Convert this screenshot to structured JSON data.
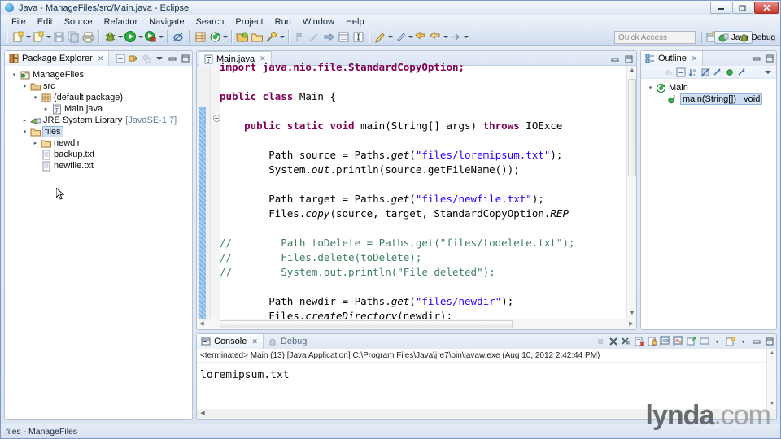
{
  "window": {
    "title": "Java - ManageFiles/src/Main.java - Eclipse",
    "minimize_label": "—",
    "restore_label": "❐",
    "close_label": "✕"
  },
  "menubar": {
    "items": [
      "File",
      "Edit",
      "Source",
      "Refactor",
      "Navigate",
      "Search",
      "Project",
      "Run",
      "Window",
      "Help"
    ]
  },
  "toolbar": {
    "quick_access_placeholder": "Quick Access",
    "perspective_java": "Java",
    "perspective_debug": "Debug",
    "icons": [
      "new-wizard-icon",
      "save-icon",
      "save-all-icon",
      "print-icon",
      "debug-icon",
      "run-icon",
      "run-external-tools-icon",
      "skip-breakpoints-icon",
      "new-java-package-icon",
      "new-java-class-icon",
      "open-type-icon",
      "search-icon",
      "annotation-icon",
      "next-annotation-icon",
      "previous-annotation-icon",
      "last-edit-location-icon",
      "back-icon",
      "forward-icon"
    ]
  },
  "package_explorer": {
    "title": "Package Explorer",
    "close_label": "✕",
    "buttons": [
      "collapse-all-icon",
      "link-with-editor-icon",
      "focus-on-active-task-icon",
      "view-menu-icon",
      "minimize-icon",
      "maximize-icon"
    ],
    "tree": [
      {
        "label": "ManageFiles",
        "icon": "java-project-icon",
        "indent": 0,
        "state": "open",
        "selected": false,
        "dim": ""
      },
      {
        "label": "src",
        "icon": "source-folder-icon",
        "indent": 1,
        "state": "open",
        "selected": false,
        "dim": ""
      },
      {
        "label": "(default package)",
        "icon": "package-icon",
        "indent": 2,
        "state": "open",
        "selected": false,
        "dim": ""
      },
      {
        "label": "Main.java",
        "icon": "java-file-icon",
        "indent": 3,
        "state": "closed",
        "selected": false,
        "dim": ""
      },
      {
        "label": "JRE System Library",
        "icon": "jre-library-icon",
        "indent": 1,
        "state": "closed",
        "selected": false,
        "dim": "[JavaSE-1.7]"
      },
      {
        "label": "files",
        "icon": "folder-icon",
        "indent": 1,
        "state": "open",
        "selected": true,
        "dim": ""
      },
      {
        "label": "newdir",
        "icon": "folder-icon",
        "indent": 2,
        "state": "closed",
        "selected": false,
        "dim": ""
      },
      {
        "label": "backup.txt",
        "icon": "text-file-icon",
        "indent": 2,
        "state": "none",
        "selected": false,
        "dim": ""
      },
      {
        "label": "newfile.txt",
        "icon": "text-file-icon",
        "indent": 2,
        "state": "none",
        "selected": false,
        "dim": ""
      }
    ]
  },
  "editor": {
    "tab_label": "Main.java",
    "tab_icon": "java-file-icon",
    "close_label": "✕",
    "buttons": [
      "minimize-icon",
      "maximize-icon"
    ],
    "lines": [
      [
        {
          "t": "import java.nio.file.StandardCopyOption;",
          "c": "kw"
        }
      ],
      [
        {
          "t": "",
          "c": "pl"
        }
      ],
      [
        {
          "t": "public class ",
          "c": "kw"
        },
        {
          "t": "Main {",
          "c": "pl"
        }
      ],
      [
        {
          "t": "",
          "c": "pl"
        }
      ],
      [
        {
          "t": "    public static void ",
          "c": "kw"
        },
        {
          "t": "main(String[] args) ",
          "c": "pl"
        },
        {
          "t": "throws ",
          "c": "kw"
        },
        {
          "t": "IOExce",
          "c": "pl"
        }
      ],
      [
        {
          "t": "",
          "c": "pl"
        }
      ],
      [
        {
          "t": "        Path source = Paths.",
          "c": "pl"
        },
        {
          "t": "get",
          "c": "stm"
        },
        {
          "t": "(",
          "c": "pl"
        },
        {
          "t": "\"files/loremipsum.txt\"",
          "c": "str"
        },
        {
          "t": ");",
          "c": "pl"
        }
      ],
      [
        {
          "t": "        System.",
          "c": "pl"
        },
        {
          "t": "out",
          "c": "stm"
        },
        {
          "t": ".println(source.getFileName());",
          "c": "pl"
        }
      ],
      [
        {
          "t": "",
          "c": "pl"
        }
      ],
      [
        {
          "t": "        Path target = Paths.",
          "c": "pl"
        },
        {
          "t": "get",
          "c": "stm"
        },
        {
          "t": "(",
          "c": "pl"
        },
        {
          "t": "\"files/newfile.txt\"",
          "c": "str"
        },
        {
          "t": ");",
          "c": "pl"
        }
      ],
      [
        {
          "t": "        Files.",
          "c": "pl"
        },
        {
          "t": "copy",
          "c": "stm"
        },
        {
          "t": "(source, target, StandardCopyOption.",
          "c": "pl"
        },
        {
          "t": "REP",
          "c": "stm"
        }
      ],
      [
        {
          "t": "",
          "c": "pl"
        }
      ],
      [
        {
          "t": "//        Path toDelete = Paths.get(\"files/todelete.txt\");",
          "c": "cmt"
        }
      ],
      [
        {
          "t": "//        Files.delete(toDelete);",
          "c": "cmt"
        }
      ],
      [
        {
          "t": "//        System.out.println(\"File deleted\");",
          "c": "cmt"
        }
      ],
      [
        {
          "t": "",
          "c": "pl"
        }
      ],
      [
        {
          "t": "        Path newdir = Paths.",
          "c": "pl"
        },
        {
          "t": "get",
          "c": "stm"
        },
        {
          "t": "(",
          "c": "pl"
        },
        {
          "t": "\"files/newdir\"",
          "c": "str"
        },
        {
          "t": ");",
          "c": "pl"
        }
      ],
      [
        {
          "t": "        Files.",
          "c": "pl"
        },
        {
          "t": "createDirectory",
          "c": "stm"
        },
        {
          "t": "(newdir);",
          "c": "pl"
        }
      ]
    ]
  },
  "outline": {
    "title": "Outline",
    "close_label": "✕",
    "toolbar_icons": [
      "hide-fields-icon",
      "hide-static-icon",
      "sort-icon",
      "hide-nonpublic-icon",
      "hide-local-types-icon",
      "show-members-icon",
      "hide-local-icon",
      "view-menu-icon"
    ],
    "buttons": [
      "minimize-icon",
      "maximize-icon"
    ],
    "items": [
      {
        "label": "Main",
        "icon": "java-class-icon",
        "indent": 0,
        "selected": false,
        "state": "open"
      },
      {
        "label": "main(String[]) : void",
        "icon": "public-static-method-icon",
        "indent": 1,
        "selected": true,
        "state": "none"
      }
    ]
  },
  "console": {
    "tab_label": "Console",
    "close_label": "✕",
    "tab_debug_label": "Debug",
    "terminated_line": "<terminated> Main (13) [Java Application] C:\\Program Files\\Java\\jre7\\bin\\javaw.exe (Aug 10, 2012 2:42:44 PM)",
    "output": "loremipsum.txt",
    "buttons": [
      "terminate-icon",
      "remove-launch-icon",
      "remove-all-launches-icon",
      "clear-console-icon",
      "scroll-lock-icon",
      "show-console-on-output-icon",
      "show-console-on-error-icon",
      "pin-console-icon",
      "display-selected-console-icon",
      "open-console-icon",
      "minimize-icon",
      "maximize-icon"
    ]
  },
  "statusbar": {
    "text": "files - ManageFiles"
  },
  "watermark": {
    "bold": "lynda",
    "light": ".com"
  },
  "colors": {
    "keyword": "#7f0055",
    "string": "#2a00ff",
    "comment": "#3f7f5f",
    "selection": "#cfe0f5",
    "chrome": "#d6e1f0"
  }
}
